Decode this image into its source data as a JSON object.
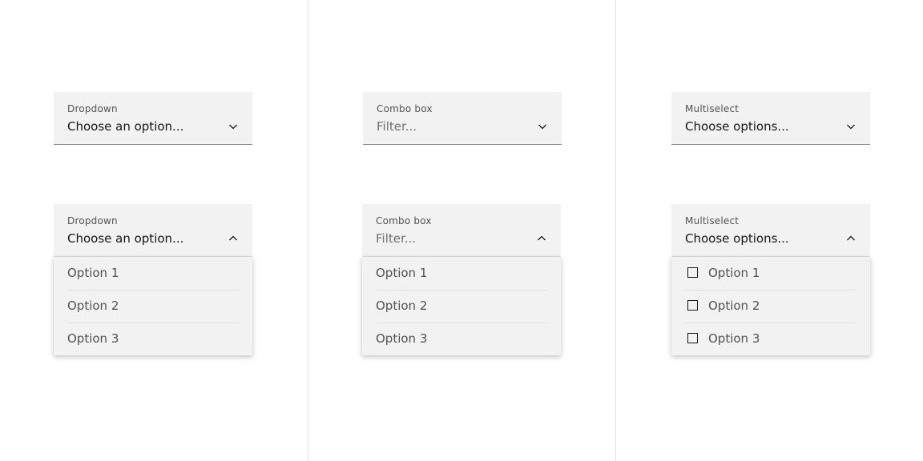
{
  "columns": [
    {
      "name": "dropdown",
      "closed": {
        "label": "Dropdown",
        "value": "Choose an option...",
        "icon": "chevron-down-icon"
      },
      "open": {
        "label": "Dropdown",
        "value": "Choose an option...",
        "icon": "chevron-up-icon",
        "options": [
          "Option 1",
          "Option 2",
          "Option 3"
        ]
      }
    },
    {
      "name": "combo-box",
      "closed": {
        "label": "Combo box",
        "placeholder": "Filter...",
        "icon": "chevron-down-icon"
      },
      "open": {
        "label": "Combo box",
        "placeholder": "Filter...",
        "icon": "chevron-up-icon",
        "options": [
          "Option 1",
          "Option 2",
          "Option 3"
        ]
      }
    },
    {
      "name": "multiselect",
      "closed": {
        "label": "Multiselect",
        "value": "Choose options...",
        "icon": "chevron-down-icon"
      },
      "open": {
        "label": "Multiselect",
        "value": "Choose options...",
        "icon": "chevron-up-icon",
        "options": [
          {
            "label": "Option 1",
            "checked": false
          },
          {
            "label": "Option 2",
            "checked": false
          },
          {
            "label": "Option 3",
            "checked": false
          }
        ]
      }
    }
  ],
  "colors": {
    "field_bg": "#f2f2f2",
    "text_primary": "#161616",
    "text_secondary": "#525252",
    "border_strong": "#8d8d8d",
    "border_subtle": "#e0e0e0"
  }
}
